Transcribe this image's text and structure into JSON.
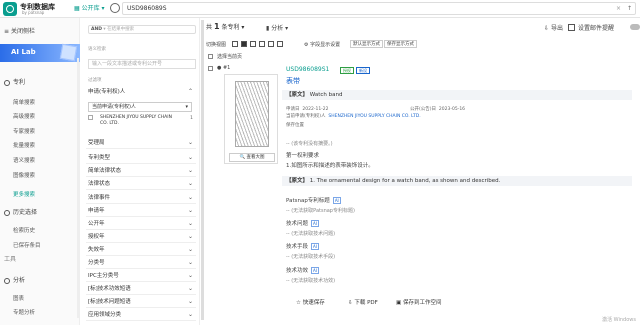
{
  "header": {
    "logo_title": "专利数据库",
    "logo_sub": "by patsnap",
    "library_label": "公开库",
    "search_value": "USD986089S",
    "search_count": "↑"
  },
  "sidebar": {
    "collapse": "关闭侧栏",
    "ailab": "AI Lab",
    "patent": "专利",
    "items": [
      "简单搜索",
      "高级搜索",
      "专家搜索",
      "批量搜索",
      "语义搜索",
      "图像搜索",
      "更多搜索"
    ],
    "history_section": "历史选择",
    "history_items": [
      "检索历史",
      "已保存条目"
    ],
    "tools": "工具",
    "analysis": "分析",
    "analysis_items": [
      "图表",
      "专题分析"
    ]
  },
  "filters": {
    "and_label": "AND",
    "and_placeholder": "在结果中搜索",
    "within_label": "语义检索",
    "within_placeholder": "输入一段文本描述或专利公开号",
    "filter_label": "过滤项",
    "applicant_header": "申请(专利权)人",
    "applicant_select": "当前申请(专利权)人",
    "company": "SHENZHEN JIYOU SUPPLY CHAIN CO. LTD.",
    "company_count": "1",
    "rows": [
      "受理局",
      "专利类型",
      "简单法律状态",
      "法律状态",
      "法律事件",
      "申请年",
      "公开年",
      "授权年",
      "失效年",
      "分类号",
      "IPC主分类号",
      "[标]技术功效短语",
      "[标]技术问题短语",
      "应用领域分类"
    ]
  },
  "results": {
    "count_prefix": "共",
    "count": "1",
    "count_suffix": "条专利",
    "analysis": "分析",
    "export": "导出",
    "settings": "设置邮件提醒",
    "view_label": "切换视图",
    "fields_label": "字段显示设置",
    "btn_default": "默认显示方式",
    "btn_save": "保存显示方式",
    "select_current": "选择当前页",
    "item_no": "#1",
    "item_id": "USD986089S1",
    "badge_green": "授权",
    "badge_blue": "新设",
    "title": "表带",
    "preview_btn": "查看大图",
    "sec_title_label": "【原文】",
    "sec_title": "Watch band",
    "apply_date_label": "申请日",
    "apply_date": "2022-11-22",
    "pub_date_label": "公开(公告)日",
    "pub_date": "2023-05-16",
    "applicant_label": "当前申请(专利权)人",
    "applicant": "SHENZHEN JIYOU SUPPLY CHAIN CO. LTD.",
    "invalid": "保存位置",
    "abstract_empty": "-- (该专利没有摘要。)",
    "claim_label": "第一权利要求",
    "claim_text": "1.如图所示和描述的表带装饰设计。",
    "sec2_label": "【原文】",
    "sec2_text": "1. The ornamental design for a watch band, as shown and described.",
    "patsnap_title": "Patsnap专利标题",
    "patsnap_title_val": "-- (无法获取Patsnap专利标题)",
    "tech_problem": "技术问题",
    "tech_problem_val": "-- (无法获取技术问题)",
    "tech_means": "技术手段",
    "tech_means_val": "-- (无法获取技术手段)",
    "tech_effect": "技术功效",
    "tech_effect_val": "-- (无法获取技术功效)",
    "ai_tag": "AI",
    "act_save": "快速保存",
    "act_pdf": "下载 PDF",
    "act_workspace": "保存到工作空间"
  },
  "watermark": "激活 Windows"
}
